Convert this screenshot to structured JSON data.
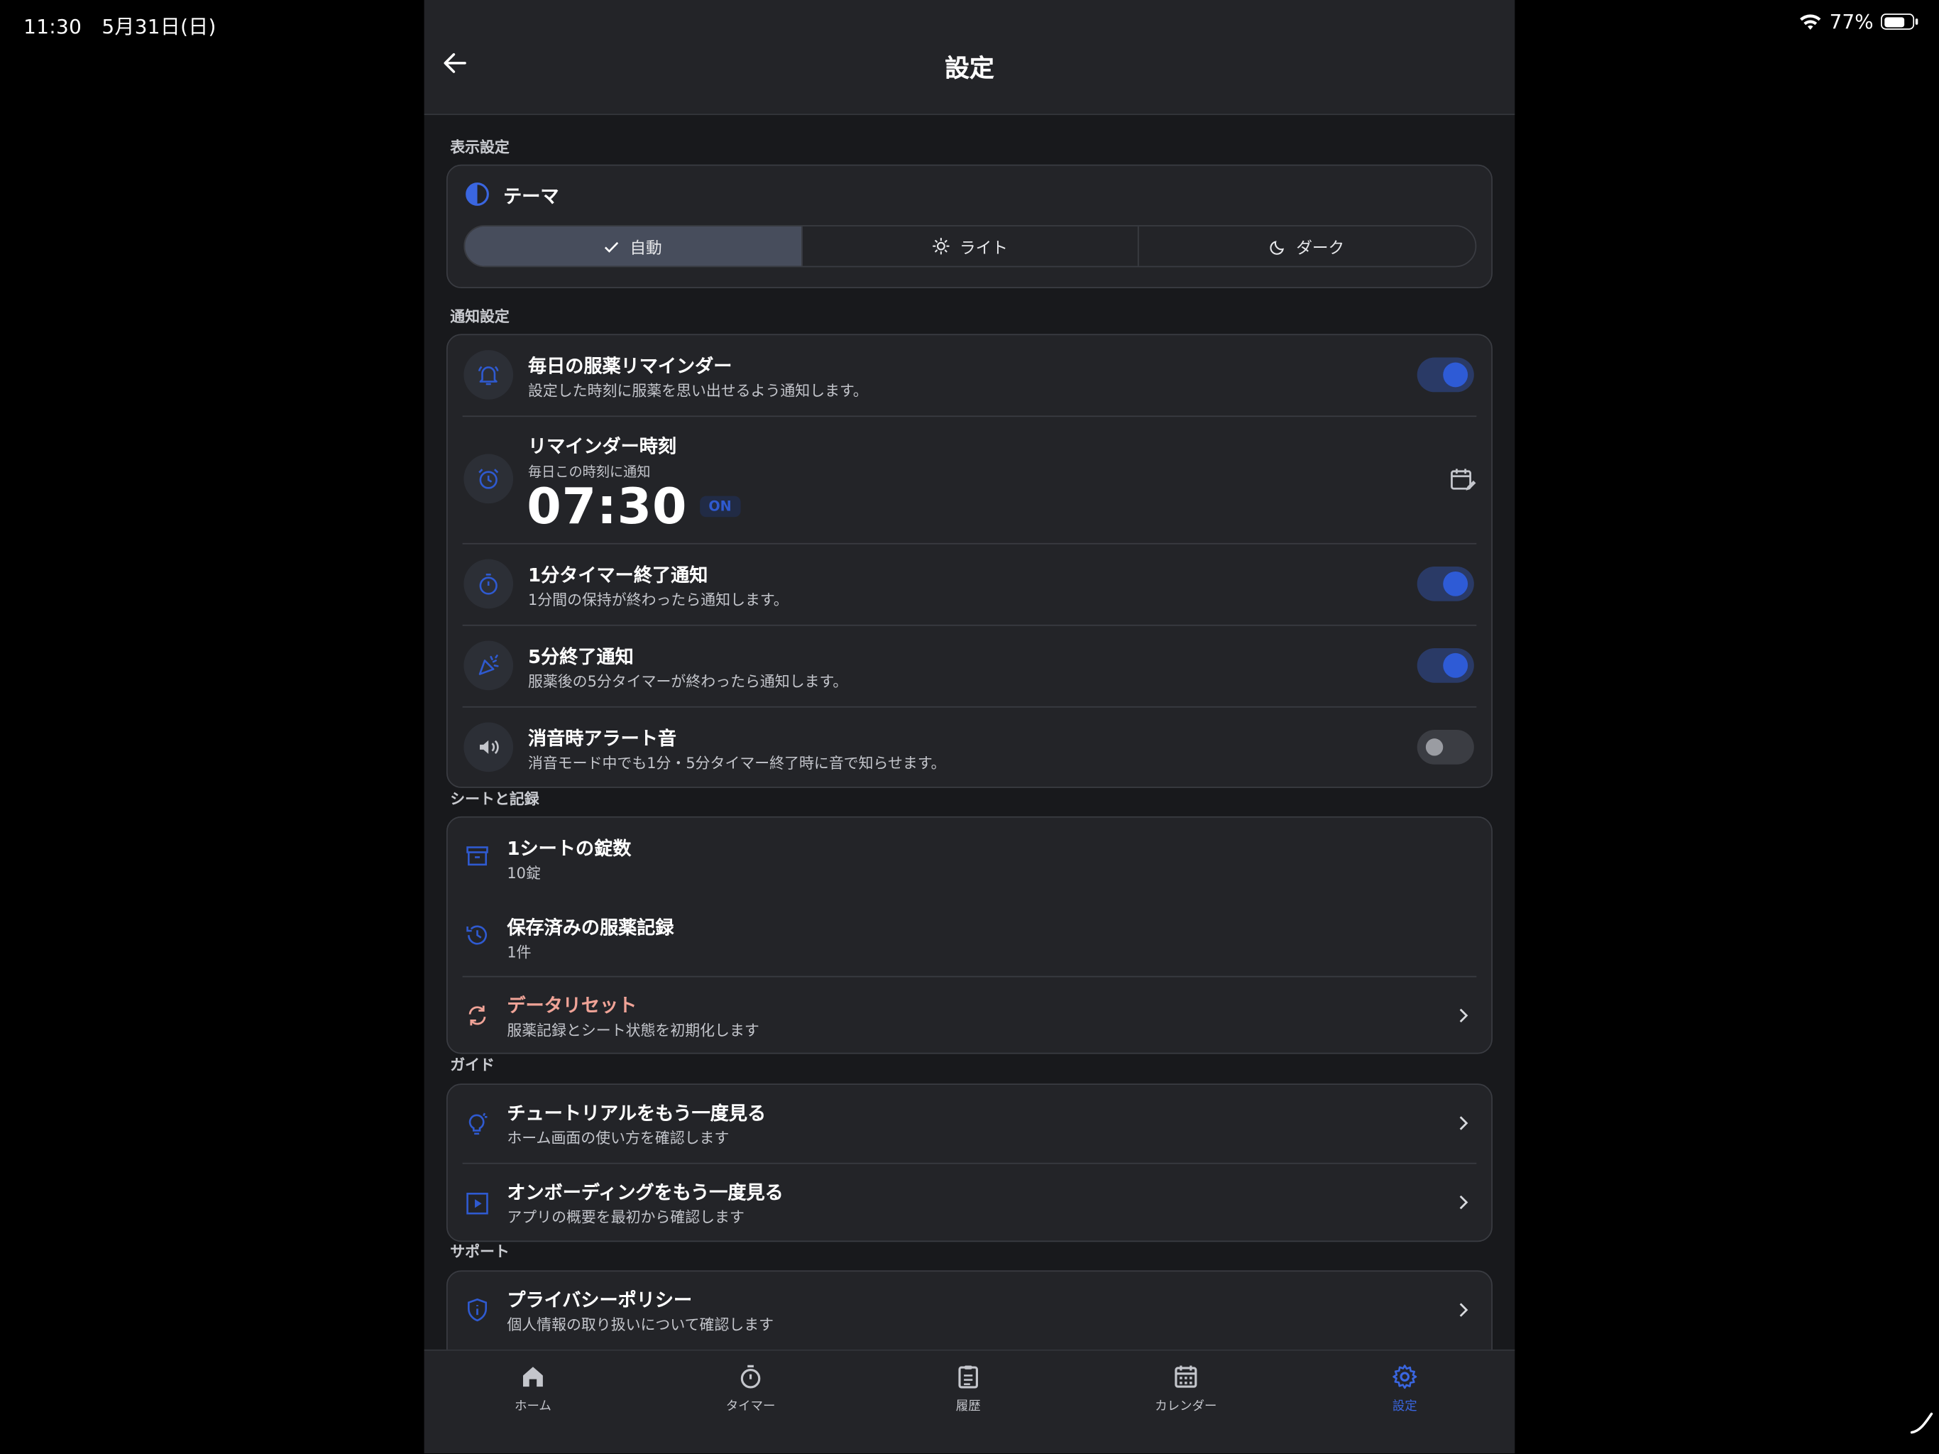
{
  "status_bar": {
    "time_date": "11:30　5月31日(日)",
    "battery": "77%",
    "battery_level": 0.77
  },
  "header": {
    "title": "設定"
  },
  "display": {
    "section": "表示設定",
    "theme_label": "テーマ",
    "options": [
      "自動",
      "ライト",
      "ダーク"
    ],
    "selected": "自動"
  },
  "notifications": {
    "section": "通知設定",
    "daily": {
      "title": "毎日の服薬リマインダー",
      "sub": "設定した時刻に服薬を思い出せるよう通知します。",
      "enabled": true
    },
    "reminder_time": {
      "title": "リマインダー時刻",
      "sub": "毎日この時刻に通知",
      "time": "07:30",
      "badge": "ON"
    },
    "timer1": {
      "title": "1分タイマー終了通知",
      "sub": "1分間の保持が終わったら通知します。",
      "enabled": true
    },
    "timer5": {
      "title": "5分終了通知",
      "sub": "服薬後の5分タイマーが終わったら通知します。",
      "enabled": true
    },
    "silent": {
      "title": "消音時アラート音",
      "sub": "消音モード中でも1分・5分タイマー終了時に音で知らせます。",
      "enabled": false
    }
  },
  "sheet": {
    "section": "シートと記録",
    "tablets": {
      "title": "1シートの錠数",
      "value": "10錠"
    },
    "records": {
      "title": "保存済みの服薬記録",
      "value": "1件"
    },
    "reset": {
      "title": "データリセット",
      "sub": "服薬記録とシート状態を初期化します"
    }
  },
  "guide": {
    "section": "ガイド",
    "tutorial": {
      "title": "チュートリアルをもう一度見る",
      "sub": "ホーム画面の使い方を確認します"
    },
    "onboarding": {
      "title": "オンボーディングをもう一度見る",
      "sub": "アプリの概要を最初から確認します"
    }
  },
  "support": {
    "section": "サポート",
    "privacy": {
      "title": "プライバシーポリシー",
      "sub": "個人情報の取り扱いについて確認します"
    }
  },
  "nav": [
    {
      "label": "ホーム",
      "icon": "home-icon"
    },
    {
      "label": "タイマー",
      "icon": "timer-icon"
    },
    {
      "label": "履歴",
      "icon": "clipboard-icon"
    },
    {
      "label": "カレンダー",
      "icon": "calendar-icon"
    },
    {
      "label": "設定",
      "icon": "gear-icon",
      "active": true
    }
  ],
  "colors": {
    "accent": "#3a66e0",
    "danger": "#f0a397",
    "background": "#18191c",
    "card": "#232428"
  }
}
